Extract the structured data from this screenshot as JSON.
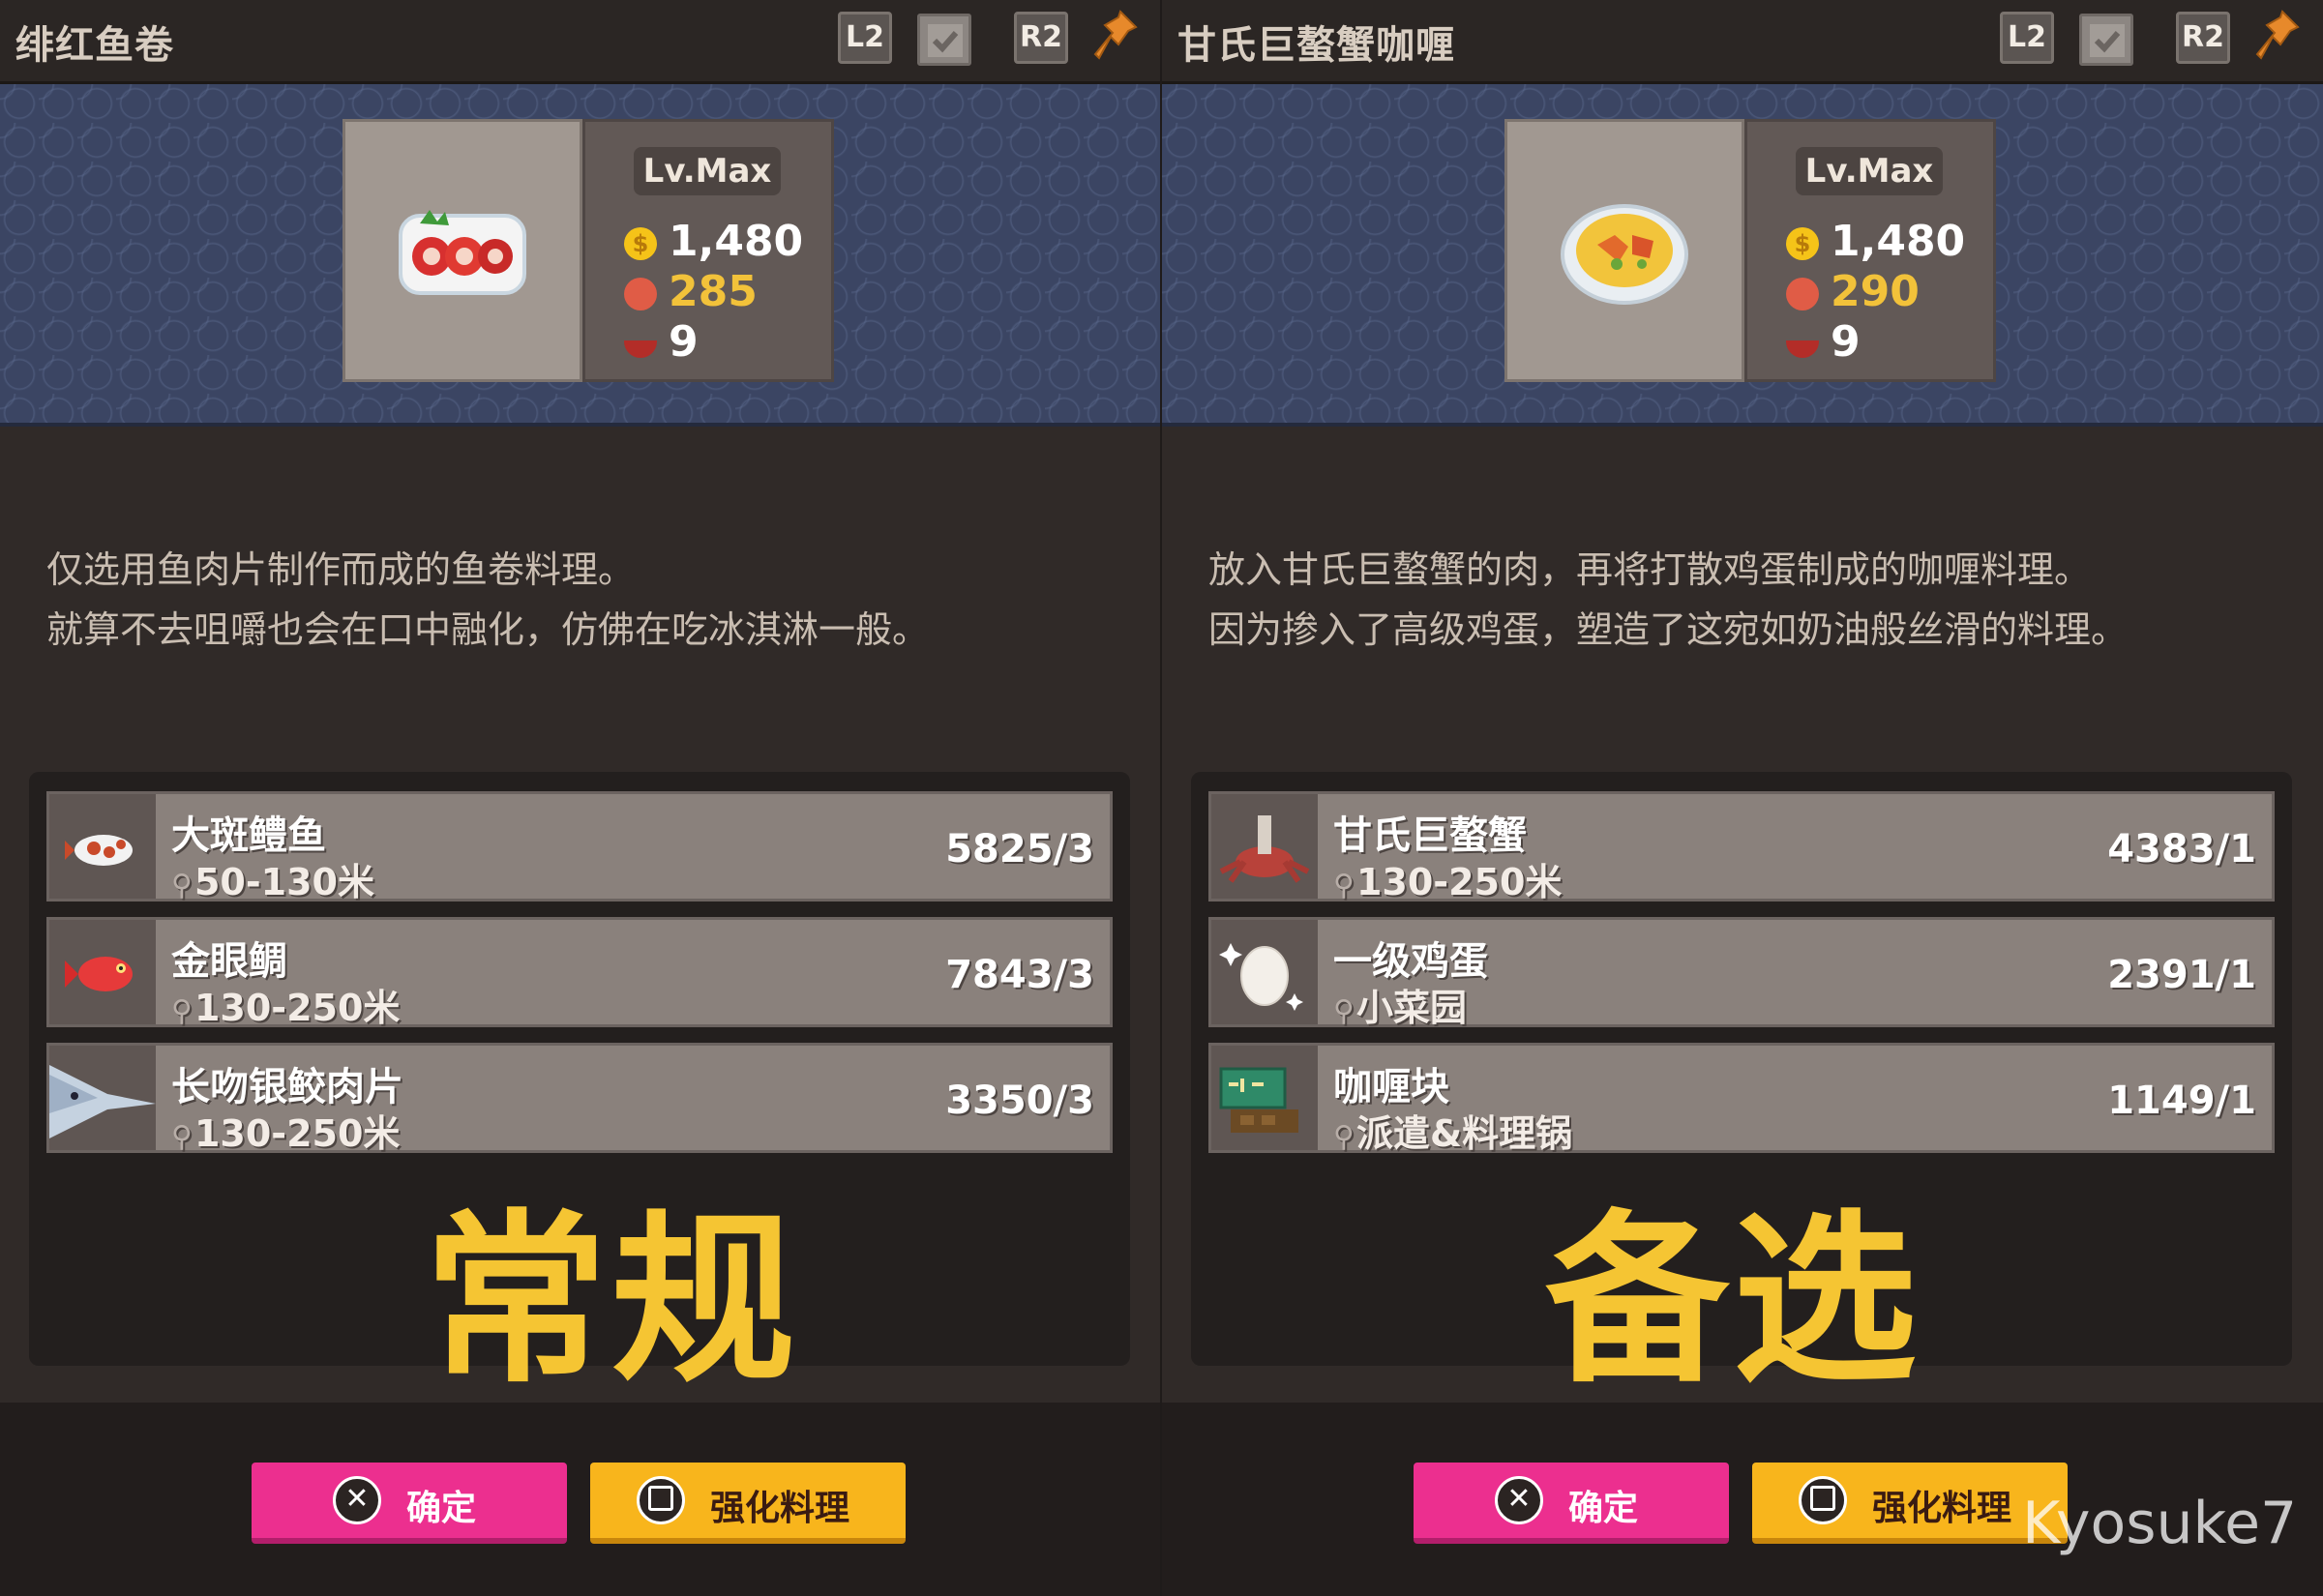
{
  "shared": {
    "shoulder_left": "L2",
    "shoulder_right": "R2",
    "level": "Lv.Max",
    "confirm_label": "确定",
    "enhance_label": "强化料理",
    "accent_colors": {
      "confirm": "#ec2f8f",
      "enhance": "#f8b51c",
      "overlay_text": "#f5c533"
    }
  },
  "left": {
    "title": "绯红鱼卷",
    "price": "1,480",
    "popularity": "285",
    "servings": "9",
    "description_line1": "仅选用鱼肉片制作而成的鱼卷料理。",
    "description_line2": "就算不去咀嚼也会在口中融化，仿佛在吃冰淇淋一般。",
    "ingredients": [
      {
        "name": "大斑鳢鱼",
        "location": "50-130米",
        "count": "5825/3",
        "icon": "snakehead-fish-icon"
      },
      {
        "name": "金眼鲷",
        "location": "130-250米",
        "count": "7843/3",
        "icon": "red-fish-icon"
      },
      {
        "name": "长吻银鲛肉片",
        "location": "130-250米",
        "count": "3350/3",
        "icon": "chimaera-fillet-icon"
      }
    ],
    "overlay": "常规"
  },
  "right": {
    "title": "甘氏巨螯蟹咖喱",
    "price": "1,480",
    "popularity": "290",
    "servings": "9",
    "description_line1": "放入甘氏巨螯蟹的肉，再将打散鸡蛋制成的咖喱料理。",
    "description_line2": "因为掺入了高级鸡蛋，塑造了这宛如奶油般丝滑的料理。",
    "ingredients": [
      {
        "name": "甘氏巨螯蟹",
        "location": "130-250米",
        "count": "4383/1",
        "icon": "giant-crab-icon"
      },
      {
        "name": "一级鸡蛋",
        "location": "小菜园",
        "count": "2391/1",
        "icon": "egg-icon"
      },
      {
        "name": "咖喱块",
        "location": "派遣&料理锅",
        "count": "1149/1",
        "icon": "curry-block-icon"
      }
    ],
    "overlay": "备选"
  },
  "signature": "Kyosuke7"
}
